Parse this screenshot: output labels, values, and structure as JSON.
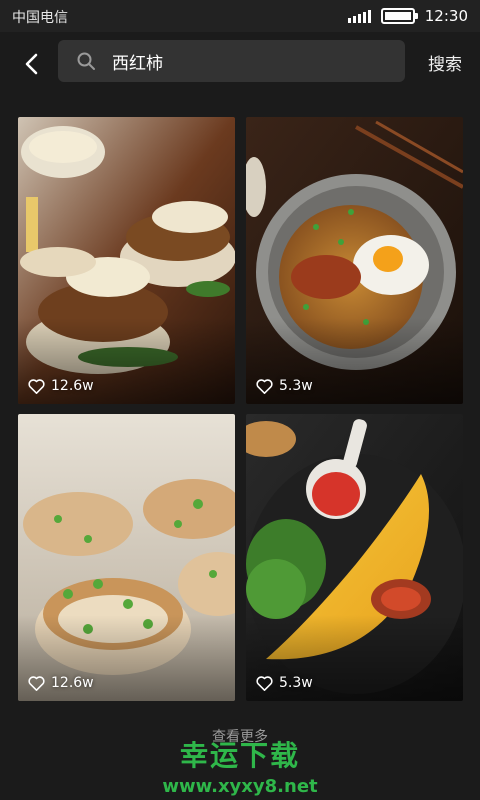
{
  "status_bar": {
    "carrier": "中国电信",
    "time": "12:30",
    "battery_level": 1.0
  },
  "search": {
    "query": "西红柿",
    "button_label": "搜索"
  },
  "results": [
    {
      "likes": "12.6w"
    },
    {
      "likes": "5.3w"
    },
    {
      "likes": "12.6w"
    },
    {
      "likes": "5.3w"
    }
  ],
  "more_label": "查看更多",
  "watermark": {
    "title": "幸运下载",
    "url": "www.xyxy8.net"
  },
  "colors": {
    "background": "#1b1b1b",
    "search_box": "#333333",
    "watermark": "#2fb74a"
  },
  "icons": {
    "back": "chevron-left-icon",
    "search": "search-icon",
    "like": "heart-icon"
  }
}
